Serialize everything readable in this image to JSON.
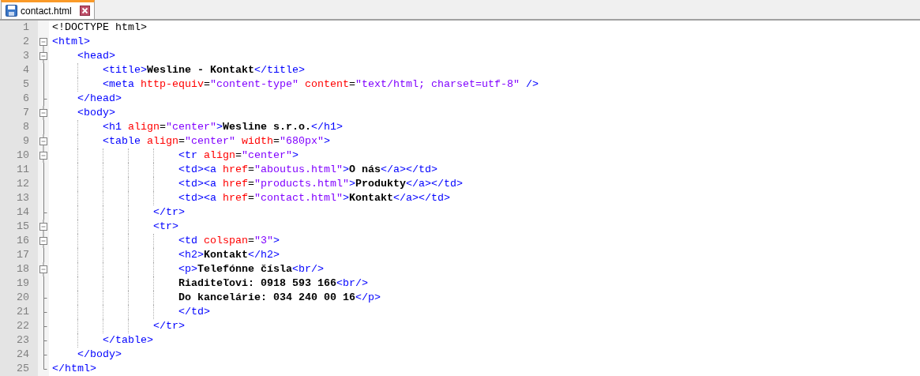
{
  "tabs": [
    {
      "label": "contact.html",
      "selected": true
    }
  ],
  "editor": {
    "lines": [
      {
        "number": "1",
        "kind": "plain",
        "tokens": [
          {
            "kind": "doctype",
            "text": "<!DOCTYPE html>"
          }
        ]
      },
      {
        "number": "2",
        "kind": "root",
        "tokens": [
          {
            "kind": "tag",
            "text": "<html>"
          }
        ]
      },
      {
        "number": "3",
        "kind": "open",
        "tokens": [
          {
            "kind": "tag",
            "text": "    <head>"
          }
        ]
      },
      {
        "number": "4",
        "kind": "line",
        "tokens": [
          {
            "kind": "tag",
            "text": "        <title>"
          },
          {
            "kind": "text",
            "text": "Wesline - Kontakt"
          },
          {
            "kind": "tag",
            "text": "</title>"
          }
        ]
      },
      {
        "number": "5",
        "kind": "line",
        "tokens": [
          {
            "kind": "tag",
            "text": "        <meta "
          },
          {
            "kind": "attr",
            "text": "http-equiv"
          },
          {
            "kind": "eq",
            "text": "="
          },
          {
            "kind": "value",
            "text": "\"content-type\" "
          },
          {
            "kind": "attr",
            "text": "content"
          },
          {
            "kind": "eq",
            "text": "="
          },
          {
            "kind": "value",
            "text": "\"text/html; charset=utf-8\""
          },
          {
            "kind": "tag",
            "text": " />"
          }
        ]
      },
      {
        "number": "6",
        "kind": "close",
        "tokens": [
          {
            "kind": "tag",
            "text": "    </head>"
          }
        ]
      },
      {
        "number": "7",
        "kind": "open",
        "tokens": [
          {
            "kind": "tag",
            "text": "    <body>"
          }
        ]
      },
      {
        "number": "8",
        "kind": "line",
        "tokens": [
          {
            "kind": "tag",
            "text": "        <h1 "
          },
          {
            "kind": "attr",
            "text": "align"
          },
          {
            "kind": "eq",
            "text": "="
          },
          {
            "kind": "value",
            "text": "\"center\""
          },
          {
            "kind": "tag",
            "text": ">"
          },
          {
            "kind": "text",
            "text": "Wesline s.r.o."
          },
          {
            "kind": "tag",
            "text": "</h1>"
          }
        ]
      },
      {
        "number": "9",
        "kind": "open",
        "tokens": [
          {
            "kind": "tag",
            "text": "        <table "
          },
          {
            "kind": "attr",
            "text": "align"
          },
          {
            "kind": "eq",
            "text": "="
          },
          {
            "kind": "value",
            "text": "\"center\" "
          },
          {
            "kind": "attr",
            "text": "width"
          },
          {
            "kind": "eq",
            "text": "="
          },
          {
            "kind": "value",
            "text": "\"680px\""
          },
          {
            "kind": "tag",
            "text": ">"
          }
        ]
      },
      {
        "number": "10",
        "kind": "open",
        "tokens": [
          {
            "kind": "tag",
            "text": "                    <tr "
          },
          {
            "kind": "attr",
            "text": "align"
          },
          {
            "kind": "eq",
            "text": "="
          },
          {
            "kind": "value",
            "text": "\"center\""
          },
          {
            "kind": "tag",
            "text": ">"
          }
        ]
      },
      {
        "number": "11",
        "kind": "line",
        "tokens": [
          {
            "kind": "tag",
            "text": "                    <td><a "
          },
          {
            "kind": "attr",
            "text": "href"
          },
          {
            "kind": "eq",
            "text": "="
          },
          {
            "kind": "value",
            "text": "\"aboutus.html\""
          },
          {
            "kind": "tag",
            "text": ">"
          },
          {
            "kind": "text",
            "text": "O nás"
          },
          {
            "kind": "tag",
            "text": "</a></td>"
          }
        ]
      },
      {
        "number": "12",
        "kind": "line",
        "tokens": [
          {
            "kind": "tag",
            "text": "                    <td><a "
          },
          {
            "kind": "attr",
            "text": "href"
          },
          {
            "kind": "eq",
            "text": "="
          },
          {
            "kind": "value",
            "text": "\"products.html\""
          },
          {
            "kind": "tag",
            "text": ">"
          },
          {
            "kind": "text",
            "text": "Produkty"
          },
          {
            "kind": "tag",
            "text": "</a></td>"
          }
        ]
      },
      {
        "number": "13",
        "kind": "line",
        "tokens": [
          {
            "kind": "tag",
            "text": "                    <td><a "
          },
          {
            "kind": "attr",
            "text": "href"
          },
          {
            "kind": "eq",
            "text": "="
          },
          {
            "kind": "value",
            "text": "\"contact.html\""
          },
          {
            "kind": "tag",
            "text": ">"
          },
          {
            "kind": "text",
            "text": "Kontakt"
          },
          {
            "kind": "tag",
            "text": "</a></td>"
          }
        ]
      },
      {
        "number": "14",
        "kind": "close",
        "tokens": [
          {
            "kind": "tag",
            "text": "                </tr>"
          }
        ]
      },
      {
        "number": "15",
        "kind": "open",
        "tokens": [
          {
            "kind": "tag",
            "text": "                <tr>"
          }
        ]
      },
      {
        "number": "16",
        "kind": "open",
        "tokens": [
          {
            "kind": "tag",
            "text": "                    <td "
          },
          {
            "kind": "attr",
            "text": "colspan"
          },
          {
            "kind": "eq",
            "text": "="
          },
          {
            "kind": "value",
            "text": "\"3\""
          },
          {
            "kind": "tag",
            "text": ">"
          }
        ]
      },
      {
        "number": "17",
        "kind": "line",
        "tokens": [
          {
            "kind": "tag",
            "text": "                    <h2>"
          },
          {
            "kind": "text",
            "text": "Kontakt"
          },
          {
            "kind": "tag",
            "text": "</h2>"
          }
        ]
      },
      {
        "number": "18",
        "kind": "open",
        "tokens": [
          {
            "kind": "tag",
            "text": "                    <p>"
          },
          {
            "kind": "text",
            "text": "Telefónne čísla"
          },
          {
            "kind": "tag",
            "text": "<br/>"
          }
        ]
      },
      {
        "number": "19",
        "kind": "line",
        "tokens": [
          {
            "kind": "text",
            "text": "                    Riaditeľovi: 0918 593 166"
          },
          {
            "kind": "tag",
            "text": "<br/>"
          }
        ]
      },
      {
        "number": "20",
        "kind": "close",
        "tokens": [
          {
            "kind": "text",
            "text": "                    Do kancelárie: 034 240 00 16"
          },
          {
            "kind": "tag",
            "text": "</p>"
          }
        ]
      },
      {
        "number": "21",
        "kind": "close",
        "tokens": [
          {
            "kind": "tag",
            "text": "                    </td>"
          }
        ]
      },
      {
        "number": "22",
        "kind": "close",
        "tokens": [
          {
            "kind": "tag",
            "text": "                </tr>"
          }
        ]
      },
      {
        "number": "23",
        "kind": "close",
        "tokens": [
          {
            "kind": "tag",
            "text": "        </table>"
          }
        ]
      },
      {
        "number": "24",
        "kind": "close",
        "tokens": [
          {
            "kind": "tag",
            "text": "    </body>"
          }
        ]
      },
      {
        "number": "25",
        "kind": "end",
        "tokens": [
          {
            "kind": "tag",
            "text": "</html>"
          }
        ]
      }
    ]
  }
}
